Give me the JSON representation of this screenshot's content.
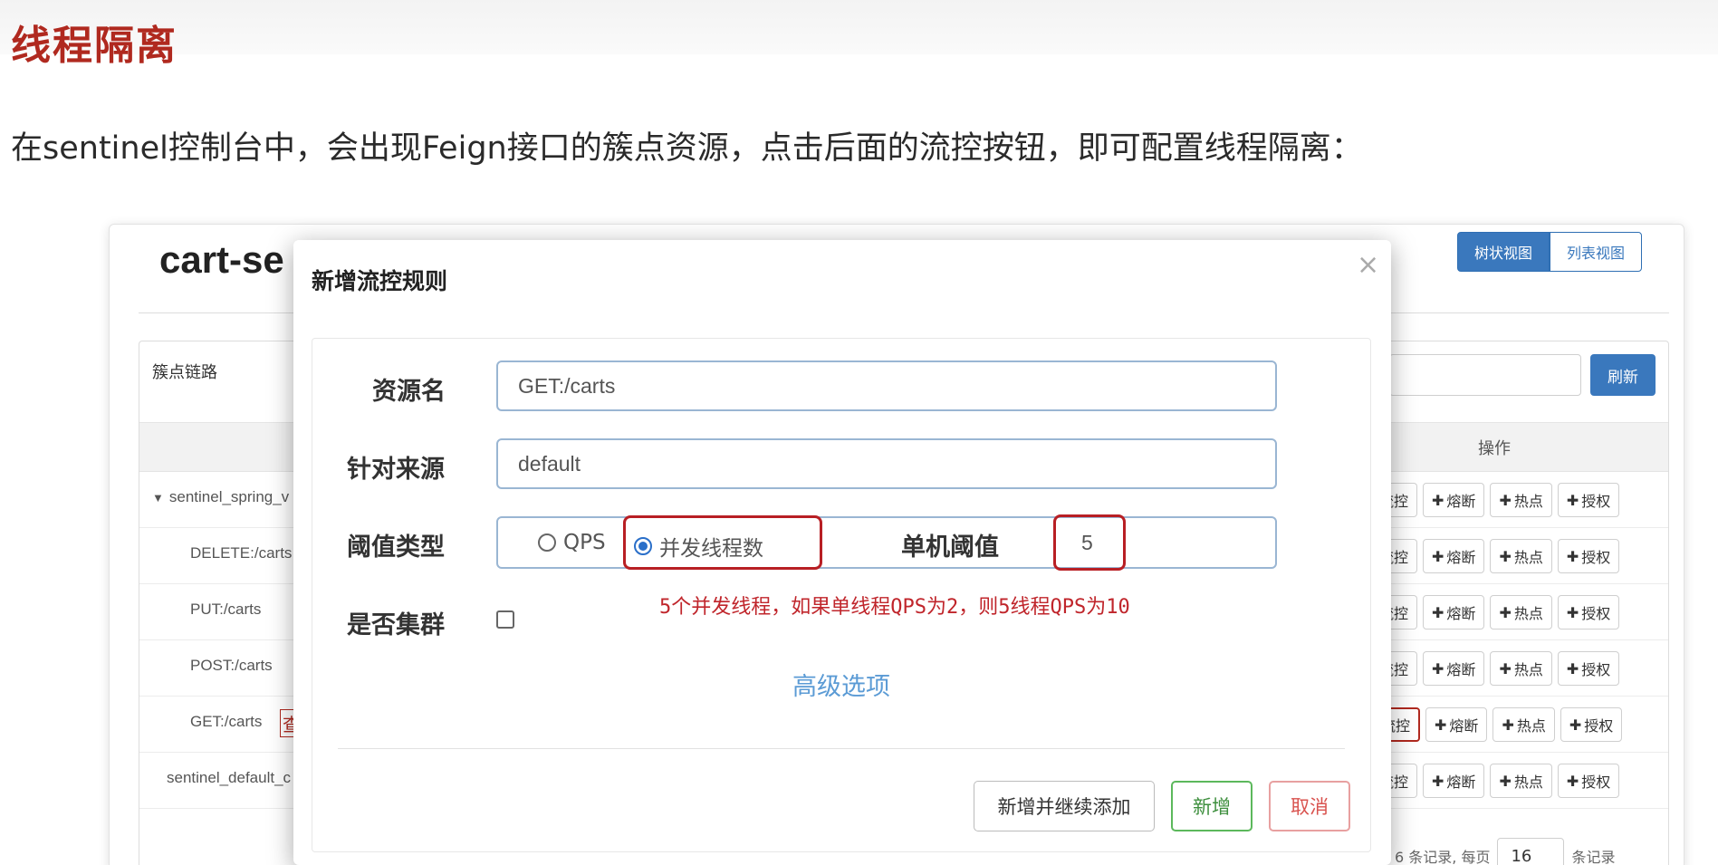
{
  "doc": {
    "title": "线程隔离",
    "paragraph": "在sentinel控制台中，会出现Feign接口的簇点资源，点击后面的流控按钮，即可配置线程隔离："
  },
  "app": {
    "title_visible": "cart-se",
    "view_tree": "树状视图",
    "view_list": "列表视图",
    "panel_label": "簇点链路",
    "refresh": "刷新",
    "ops_header": "操作",
    "rows": [
      {
        "label": "sentinel_spring_v",
        "caret": "▼"
      },
      {
        "label": "DELETE:/carts"
      },
      {
        "label": "PUT:/carts"
      },
      {
        "label": "POST:/carts"
      },
      {
        "label": "GET:/carts",
        "red_fragment": "查"
      },
      {
        "label": "sentinel_default_c"
      }
    ],
    "ops": {
      "flow_partial": "流控",
      "degrade": "熔断",
      "hotspot": "热点",
      "auth": "授权",
      "plus": "✚"
    },
    "pager": {
      "prefix": "6 条记录, 每页",
      "page_size": "16",
      "suffix": "条记录"
    }
  },
  "modal": {
    "title": "新增流控规则",
    "close_icon": "×",
    "resource_label": "资源名",
    "resource_value": "GET:/carts",
    "origin_label": "针对来源",
    "origin_value": "default",
    "threshold_type_label": "阈值类型",
    "radio_qps": "QPS",
    "radio_threads": "并发线程数",
    "single_threshold_label": "单机阈值",
    "single_threshold_value": "5",
    "annotation": "5个并发线程，如果单线程QPS为2，则5线程QPS为10",
    "cluster_label": "是否集群",
    "advanced": "高级选项",
    "btn_continue": "新增并继续添加",
    "btn_add": "新增",
    "btn_cancel": "取消"
  },
  "colors": {
    "heading_red": "#b0291f",
    "annotation_red": "#c0252b",
    "primary_blue": "#3a78bd",
    "success_green": "#5cb85c",
    "danger_red": "#d9534f"
  }
}
